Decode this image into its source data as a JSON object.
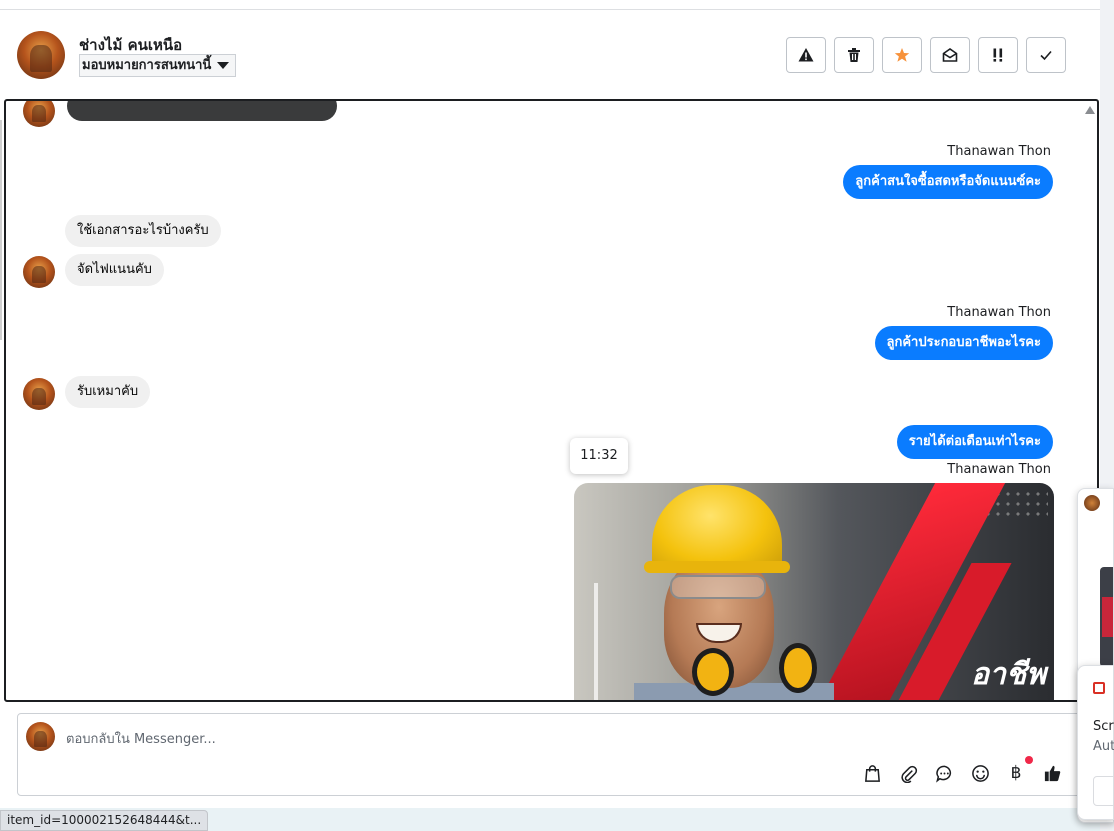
{
  "header": {
    "contact_name": "ช่างไม้ คนเหนือ",
    "assign_label": "มอบหมายการสนทนานี้",
    "actions": [
      {
        "name": "spam-button",
        "icon": "warning-icon"
      },
      {
        "name": "delete-button",
        "icon": "trash-icon"
      },
      {
        "name": "star-button",
        "icon": "star-icon"
      },
      {
        "name": "mark-unread-button",
        "icon": "envelope-open-icon"
      },
      {
        "name": "follow-up-button",
        "icon": "exclamation-icon"
      },
      {
        "name": "done-button",
        "icon": "check-icon"
      }
    ]
  },
  "conversation": {
    "messages": [
      {
        "direction": "out",
        "sender": "Thanawan Thon",
        "text": "ลูกค้าสนใจซื้อสดหรือจัดแนนซ์คะ"
      },
      {
        "direction": "in",
        "text": "ใช้เอกสารอะไรบ้างครับ"
      },
      {
        "direction": "in",
        "text": "จัดไฟแนนคับ"
      },
      {
        "direction": "out",
        "sender": "Thanawan Thon",
        "text": "ลูกค้าประกอบอาชีพอะไรคะ"
      },
      {
        "direction": "in",
        "text": "รับเหมาคับ"
      },
      {
        "direction": "out",
        "text": "รายได้ต่อเดือนเท่าไรคะ"
      },
      {
        "direction": "out",
        "sender": "Thanawan Thon",
        "type": "image",
        "image_text": "อาชีพ"
      }
    ],
    "tooltip_time": "11:32"
  },
  "composer": {
    "placeholder": "ตอบกลับใน Messenger...",
    "tools": [
      "shopping-bag-icon",
      "paperclip-icon",
      "chat-bubble-icon",
      "emoji-icon",
      "baht-icon",
      "thumbs-up-icon"
    ]
  },
  "statusbar": {
    "url_text": "item_id=100002152648444&t..."
  },
  "side_notification": {
    "title": "Scre",
    "subtitle": "Aut"
  }
}
